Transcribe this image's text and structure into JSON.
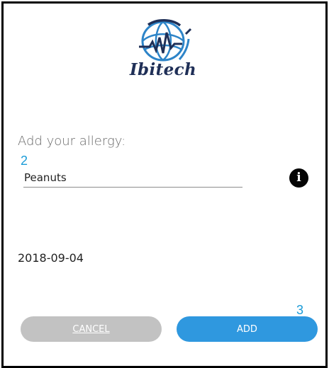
{
  "brand": {
    "name": "Ibitech",
    "logo_icon": "globe-heartbeat-icon",
    "colors": {
      "navy": "#1f2f57",
      "blue": "#2d84c8"
    }
  },
  "form": {
    "prompt": "Add your allergy:",
    "allergy_value": "Peanuts",
    "info_icon": "info-icon",
    "date": "2018-09-04"
  },
  "buttons": {
    "cancel_label": "CANCEL",
    "add_label": "ADD",
    "cancel_color": "#c2c2c2",
    "add_color": "#2f98df"
  },
  "annotations": {
    "step_2": "2",
    "step_3": "3"
  }
}
